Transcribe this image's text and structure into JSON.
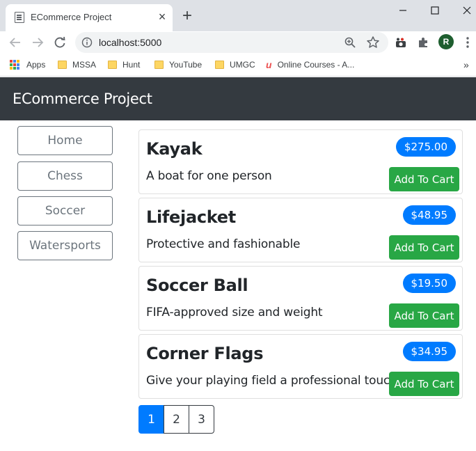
{
  "browser": {
    "tab_title": "ECommerce Project",
    "url": "localhost:5000",
    "profile_initial": "R",
    "bookmarks": [
      {
        "label": "Apps",
        "icon": "apps-grid-icon"
      },
      {
        "label": "MSSA",
        "icon": "folder-icon"
      },
      {
        "label": "Hunt",
        "icon": "folder-icon"
      },
      {
        "label": "YouTube",
        "icon": "folder-icon"
      },
      {
        "label": "UMGC",
        "icon": "folder-icon"
      },
      {
        "label": "Online Courses - A...",
        "icon": "udemy-icon"
      }
    ],
    "colors": {
      "tabstrip": "#dee1e6",
      "omnibox": "#f1f3f4",
      "profile": "#1e5e2f"
    }
  },
  "page": {
    "brand": "ECommerce Project",
    "categories": [
      "Home",
      "Chess",
      "Soccer",
      "Watersports"
    ],
    "products": [
      {
        "name": "Kayak",
        "price": "$275.00",
        "description": "A boat for one person",
        "button": "Add To Cart"
      },
      {
        "name": "Lifejacket",
        "price": "$48.95",
        "description": "Protective and fashionable",
        "button": "Add To Cart"
      },
      {
        "name": "Soccer Ball",
        "price": "$19.50",
        "description": "FIFA-approved size and weight",
        "button": "Add To Cart"
      },
      {
        "name": "Corner Flags",
        "price": "$34.95",
        "description": "Give your playing field a professional touch",
        "button": "Add To Cart"
      }
    ],
    "pages": [
      "1",
      "2",
      "3"
    ],
    "active_page": "1",
    "colors": {
      "navbar": "#343a40",
      "primary": "#007bff",
      "success": "#28a745",
      "secondary": "#6c757d"
    }
  }
}
